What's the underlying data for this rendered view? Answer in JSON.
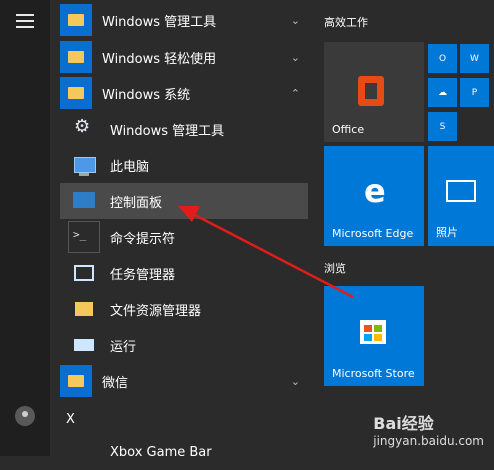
{
  "list": {
    "items": [
      {
        "label": "Windows 管理工具",
        "chev": "⌄"
      },
      {
        "label": "Windows 轻松使用",
        "chev": "⌄"
      },
      {
        "label": "Windows 系统",
        "chev": "⌃"
      },
      {
        "label": "Windows 管理工具"
      },
      {
        "label": "此电脑"
      },
      {
        "label": "控制面板"
      },
      {
        "label": "命令提示符"
      },
      {
        "label": "任务管理器"
      },
      {
        "label": "文件资源管理器"
      },
      {
        "label": "运行"
      },
      {
        "label": "微信",
        "chev": "⌄"
      },
      {
        "label": "Xbox Game Bar"
      }
    ],
    "letter_x": "X"
  },
  "tiles": {
    "group1": "高效工作",
    "group2": "浏览",
    "office": "Office",
    "edge": "Microsoft Edge",
    "photos": "照片",
    "store": "Microsoft Store",
    "small": [
      "O",
      "W",
      "☁",
      "P",
      "S"
    ]
  },
  "watermark": {
    "brand": "Bai经验",
    "url": "jingyan.baidu.com"
  },
  "colors": {
    "accent": "#0078d7",
    "arrow": "#e21b1b"
  }
}
